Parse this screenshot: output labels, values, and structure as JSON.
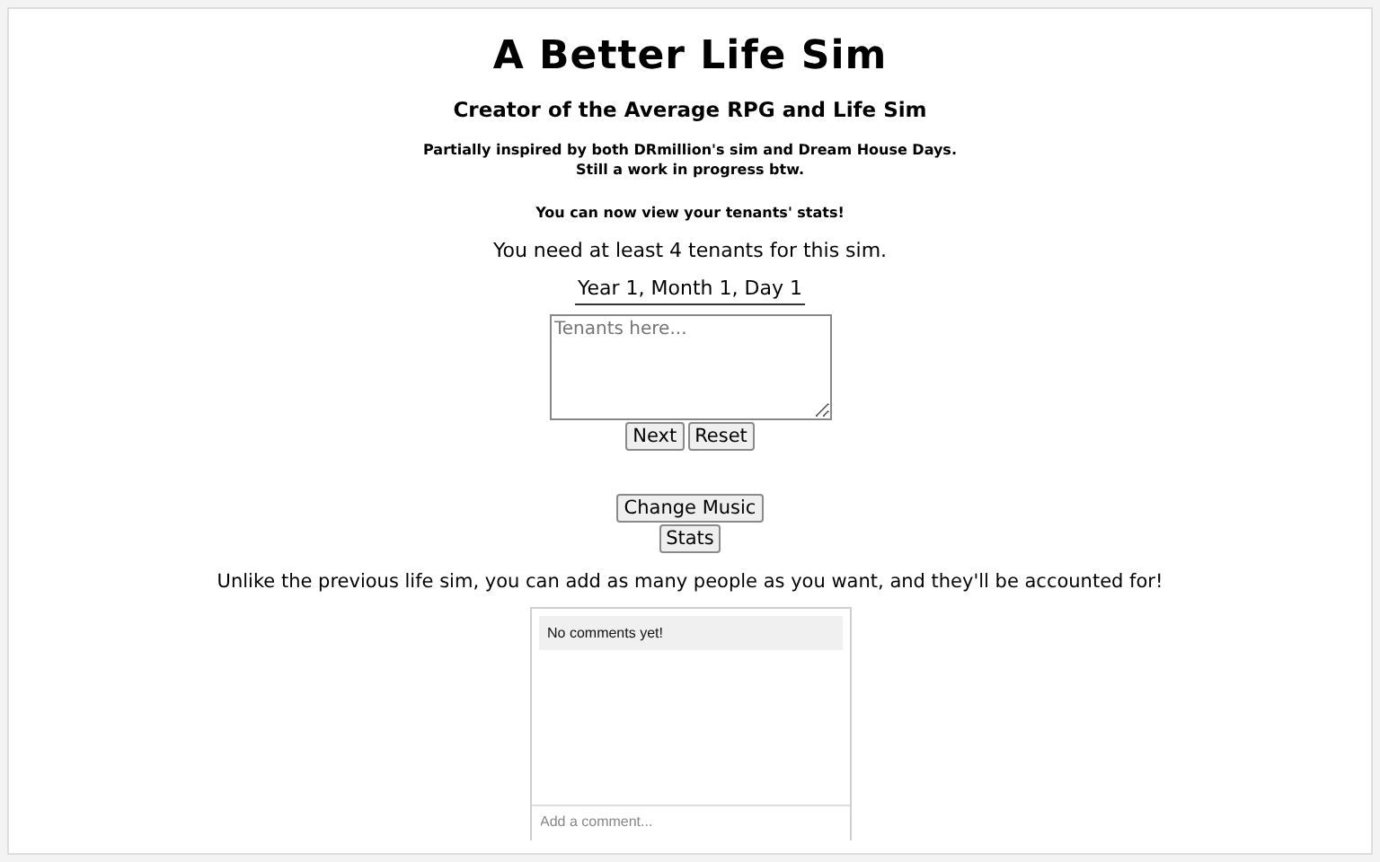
{
  "title": "A Better Life Sim",
  "subtitle": "Creator of the Average RPG and Life Sim",
  "notes": [
    "Partially inspired by both DRmillion's sim and Dream House Days.",
    "Still a work in progress btw."
  ],
  "announcement": "You can now view your tenants' stats!",
  "requirement": "You need at least 4 tenants for this sim.",
  "date": "Year 1, Month 1, Day 1",
  "tenants_field": {
    "placeholder": "Tenants here..."
  },
  "buttons": [
    "Next",
    "Reset"
  ],
  "extra_buttons": [
    "Change Music",
    "Stats"
  ],
  "description": "Unlike the previous life sim, you can add as many people as you want, and they'll be accounted for!",
  "comments": {
    "empty_message": "No comments yet!",
    "input": {
      "placeholder": "Add a comment..."
    }
  }
}
